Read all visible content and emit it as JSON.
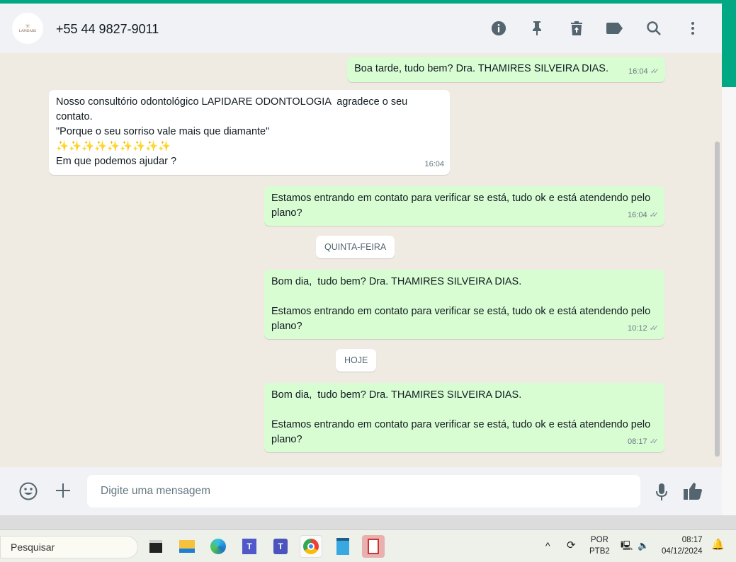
{
  "header": {
    "avatar_text": "LAPIDARE",
    "contact": "+55 44 9827-9011"
  },
  "messages": [
    {
      "dir": "out",
      "text": "Boa tarde, tudo bem? Dra. THAMIRES SILVEIRA DIAS.",
      "time": "16:04"
    },
    {
      "dir": "in",
      "text": "Nosso consultório odontológico LAPIDARE ODONTOLOGIA  agradece o seu contato.\n\"Porque o seu sorriso vale mais que diamante\"\n✨✨✨✨✨✨✨✨✨\nEm que podemos ajudar ?",
      "time": "16:04"
    },
    {
      "dir": "out",
      "text": "Estamos entrando em contato para verificar se está, tudo ok e está atendendo pelo plano?",
      "time": "16:04"
    },
    {
      "dir": "out",
      "text": "Bom dia,  tudo bem? Dra. THAMIRES SILVEIRA DIAS.\n\nEstamos entrando em contato para verificar se está, tudo ok e está atendendo pelo plano?",
      "time": "10:12"
    },
    {
      "dir": "out",
      "text": "Bom dia,  tudo bem? Dra. THAMIRES SILVEIRA DIAS.\n\nEstamos entrando em contato para verificar se está, tudo ok e está atendendo pelo plano?",
      "time": "08:17"
    }
  ],
  "dates": [
    "QUINTA-FEIRA",
    "HOJE"
  ],
  "footer": {
    "placeholder": "Digite uma mensagem"
  },
  "taskbar": {
    "search": "Pesquisar",
    "lang1": "POR",
    "lang2": "PTB2",
    "time": "08:17",
    "date": "04/12/2024"
  },
  "colors": {
    "accent": "#00a884",
    "outgoing": "#d9fdd3"
  }
}
